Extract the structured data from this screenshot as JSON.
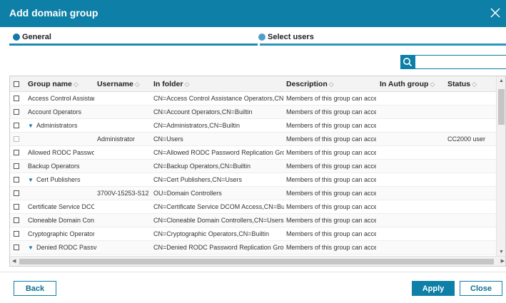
{
  "dialog": {
    "title": "Add domain group"
  },
  "steps": [
    {
      "label": "General"
    },
    {
      "label": "Select users"
    }
  ],
  "search": {
    "value": "",
    "placeholder": ""
  },
  "table": {
    "columns": [
      "Group name",
      "Username",
      "In folder",
      "Description",
      "In Auth group",
      "Status"
    ],
    "rows": [
      {
        "name": "Access Control Assistar",
        "username": "",
        "folder": "CN=Access Control Assistance Operators,CN=E",
        "description": "Members of this group can acce",
        "auth": "",
        "status": "",
        "expandable": false,
        "checkbox_disabled": false
      },
      {
        "name": "Account Operators",
        "username": "",
        "folder": "CN=Account Operators,CN=Builtin",
        "description": "Members of this group can acce",
        "auth": "",
        "status": "",
        "expandable": false,
        "checkbox_disabled": false
      },
      {
        "name": "Administrators",
        "username": "",
        "folder": "CN=Administrators,CN=Builtin",
        "description": "Members of this group can acce",
        "auth": "",
        "status": "",
        "expandable": true,
        "checkbox_disabled": false
      },
      {
        "name": "",
        "username": "Administrator",
        "folder": "CN=Users",
        "description": "Members of this group can acce",
        "auth": "",
        "status": "CC2000 user",
        "expandable": false,
        "checkbox_disabled": true
      },
      {
        "name": "Allowed RODC Passwo",
        "username": "",
        "folder": "CN=Allowed RODC Password Replication Grou",
        "description": "Members of this group can acce",
        "auth": "",
        "status": "",
        "expandable": false,
        "checkbox_disabled": false
      },
      {
        "name": "Backup Operators",
        "username": "",
        "folder": "CN=Backup Operators,CN=Builtin",
        "description": "Members of this group can acce",
        "auth": "",
        "status": "",
        "expandable": false,
        "checkbox_disabled": false
      },
      {
        "name": "Cert Publishers",
        "username": "",
        "folder": "CN=Cert Publishers,CN=Users",
        "description": "Members of this group can acce",
        "auth": "",
        "status": "",
        "expandable": true,
        "checkbox_disabled": false
      },
      {
        "name": "",
        "username": "3700V-15253-S12",
        "folder": "OU=Domain Controllers",
        "description": "Members of this group can acce",
        "auth": "",
        "status": "",
        "expandable": false,
        "checkbox_disabled": false
      },
      {
        "name": "Certificate Service DCC",
        "username": "",
        "folder": "CN=Certificate Service DCOM Access,CN=Built",
        "description": "Members of this group can acce",
        "auth": "",
        "status": "",
        "expandable": false,
        "checkbox_disabled": false
      },
      {
        "name": "Cloneable Domain Cont",
        "username": "",
        "folder": "CN=Cloneable Domain Controllers,CN=Users",
        "description": "Members of this group can acce",
        "auth": "",
        "status": "",
        "expandable": false,
        "checkbox_disabled": false
      },
      {
        "name": "Cryptographic Operator",
        "username": "",
        "folder": "CN=Cryptographic Operators,CN=Builtin",
        "description": "Members of this group can acce",
        "auth": "",
        "status": "",
        "expandable": false,
        "checkbox_disabled": false
      },
      {
        "name": "Denied RODC Passv",
        "username": "",
        "folder": "CN=Denied RODC Password Replication Group",
        "description": "Members of this group can acce",
        "auth": "",
        "status": "",
        "expandable": true,
        "checkbox_disabled": false
      }
    ]
  },
  "footer": {
    "back_label": "Back",
    "apply_label": "Apply",
    "close_label": "Close"
  },
  "colors": {
    "accent": "#0e7fa6",
    "header_bg": "#f3f3f3"
  }
}
